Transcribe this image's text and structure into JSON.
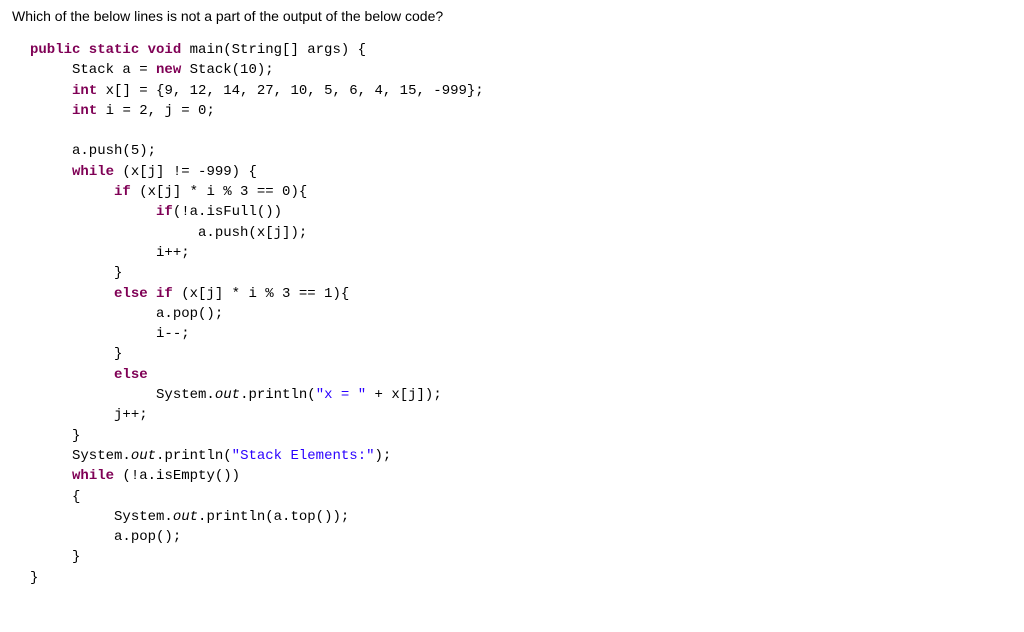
{
  "question": "Which of the below lines is not a part of the output of the below code?",
  "code": {
    "line1_kw1": "public static void",
    "line1_rest": " main(String[] args) {",
    "line2_indent": "     Stack a = ",
    "line2_kw": "new",
    "line2_rest": " Stack(10);",
    "line3_indent": "     ",
    "line3_kw": "int",
    "line3_rest": " x[] = {9, 12, 14, 27, 10, 5, 6, 4, 15, -999};",
    "line4_indent": "     ",
    "line4_kw": "int",
    "line4_rest": " i = 2, j = 0;",
    "blank1": "",
    "line5": "     a.push(5);",
    "line6_indent": "     ",
    "line6_kw": "while",
    "line6_rest": " (x[j] != -999) {",
    "line7_indent": "          ",
    "line7_kw": "if",
    "line7_rest": " (x[j] * i % 3 == 0){",
    "line8_indent": "               ",
    "line8_kw": "if",
    "line8_rest": "(!a.isFull())",
    "line9": "                    a.push(x[j]);",
    "line10": "               i++;",
    "line11": "          }",
    "line12_indent": "          ",
    "line12_kw": "else if",
    "line12_rest": " (x[j] * i % 3 == 1){",
    "line13": "               a.pop();",
    "line14": "               i--;",
    "line15": "          }",
    "line16_indent": "          ",
    "line16_kw": "else",
    "line17_indent": "               System.",
    "line17_static": "out",
    "line17_mid": ".println(",
    "line17_str": "\"x = \"",
    "line17_rest": " + x[j]);",
    "line18": "          j++;",
    "line19": "     }",
    "line20_indent": "     System.",
    "line20_static": "out",
    "line20_mid": ".println(",
    "line20_str": "\"Stack Elements:\"",
    "line20_rest": ");",
    "line21_indent": "     ",
    "line21_kw": "while",
    "line21_rest": " (!a.isEmpty())",
    "line22": "     {",
    "line23_indent": "          System.",
    "line23_static": "out",
    "line23_rest": ".println(a.top());",
    "line24": "          a.pop();",
    "line25": "     }",
    "line26": "}"
  }
}
